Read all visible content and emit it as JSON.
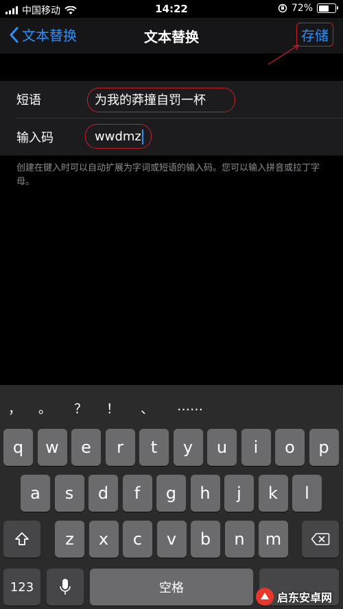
{
  "status_bar": {
    "carrier": "中国移动",
    "time": "14:22",
    "battery": "72%",
    "battery_level": 0.72
  },
  "nav": {
    "back_label": "文本替换",
    "title": "文本替换",
    "save_label": "存储"
  },
  "form": {
    "phrase_label": "短语",
    "phrase_value": "为我的莽撞自罚一杯",
    "shortcut_label": "输入码",
    "shortcut_value": "wwdmz"
  },
  "help_text": "创建在键入时可以自动扩展为字词或短语的输入码。您可以输入拼音或拉丁字母。",
  "keyboard": {
    "candidates": [
      "，",
      "。",
      "？",
      "！",
      "、",
      "……"
    ],
    "row1": [
      "q",
      "w",
      "e",
      "r",
      "t",
      "y",
      "u",
      "i",
      "o",
      "p"
    ],
    "row2": [
      "a",
      "s",
      "d",
      "f",
      "g",
      "h",
      "j",
      "k",
      "l"
    ],
    "row3": [
      "z",
      "x",
      "c",
      "v",
      "b",
      "n",
      "m"
    ],
    "numbers_label": "123",
    "space_label": "空格"
  },
  "watermark": "启东安卓网"
}
